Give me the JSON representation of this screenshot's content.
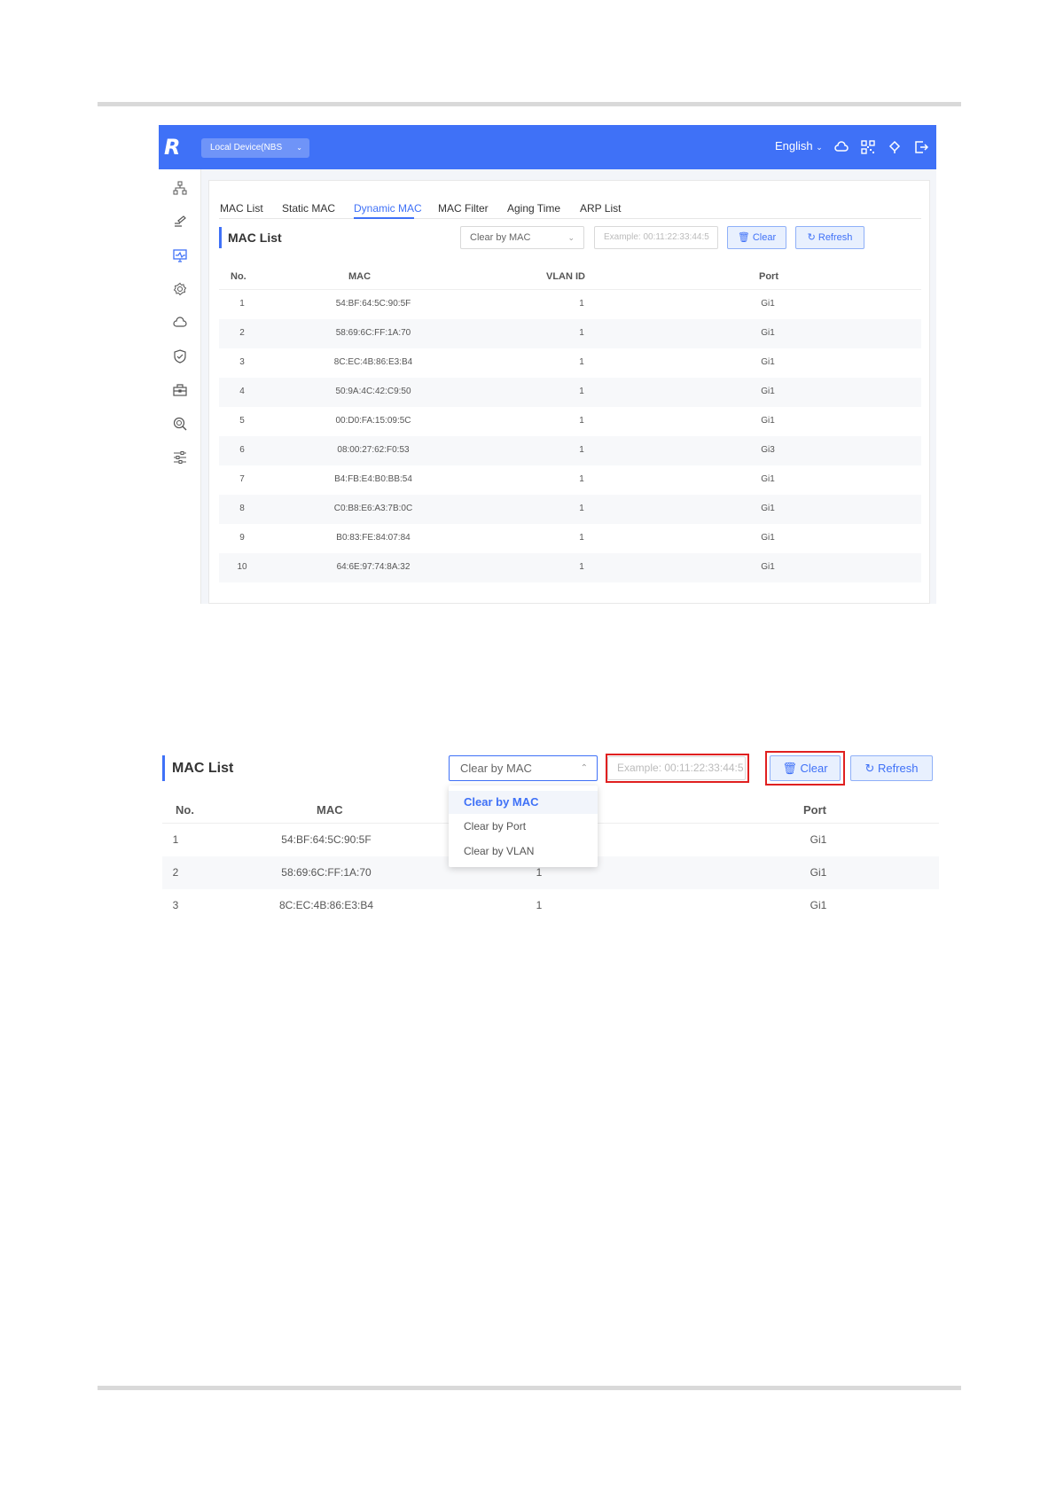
{
  "shot1": {
    "device_selector": "Local Device(NBS",
    "language": "English",
    "tabs": [
      "MAC List",
      "Static MAC",
      "Dynamic MAC",
      "MAC Filter",
      "Aging Time",
      "ARP List"
    ],
    "active_tab": "Dynamic MAC",
    "panel_title": "MAC List",
    "clear_select": "Clear by MAC",
    "mac_input_placeholder": "Example: 00:11:22:33:44:5",
    "clear_button": "Clear",
    "refresh_button": "Refresh",
    "columns": [
      "No.",
      "MAC",
      "VLAN ID",
      "Port"
    ],
    "rows": [
      [
        "1",
        "54:BF:64:5C:90:5F",
        "1",
        "Gi1"
      ],
      [
        "2",
        "58:69:6C:FF:1A:70",
        "1",
        "Gi1"
      ],
      [
        "3",
        "8C:EC:4B:86:E3:B4",
        "1",
        "Gi1"
      ],
      [
        "4",
        "50:9A:4C:42:C9:50",
        "1",
        "Gi1"
      ],
      [
        "5",
        "00:D0:FA:15:09:5C",
        "1",
        "Gi1"
      ],
      [
        "6",
        "08:00:27:62:F0:53",
        "1",
        "Gi3"
      ],
      [
        "7",
        "B4:FB:E4:B0:BB:54",
        "1",
        "Gi1"
      ],
      [
        "8",
        "C0:B8:E6:A3:7B:0C",
        "1",
        "Gi1"
      ],
      [
        "9",
        "B0:83:FE:84:07:84",
        "1",
        "Gi1"
      ],
      [
        "10",
        "64:6E:97:74:8A:32",
        "1",
        "Gi1"
      ]
    ]
  },
  "shot2": {
    "panel_title": "MAC List",
    "clear_select": "Clear by MAC",
    "mac_input_placeholder": "Example: 00:11:22:33:44:5",
    "clear_button": "Clear",
    "refresh_button": "Refresh",
    "dropdown_options": [
      "Clear by MAC",
      "Clear by Port",
      "Clear by VLAN"
    ],
    "columns": [
      "No.",
      "MAC",
      "Port"
    ],
    "rows": [
      [
        "1",
        "54:BF:64:5C:90:5F",
        "",
        "Gi1"
      ],
      [
        "2",
        "58:69:6C:FF:1A:70",
        "1",
        "Gi1"
      ],
      [
        "3",
        "8C:EC:4B:86:E3:B4",
        "1",
        "Gi1"
      ]
    ]
  },
  "colors": {
    "accent": "#3f71f7",
    "highlight": "#e02020"
  },
  "icons": {
    "topbar": [
      "cloud-icon",
      "qr-code-icon",
      "notification-icon",
      "logout-icon"
    ],
    "sidebar": [
      "topology-icon",
      "ports-icon",
      "monitor-icon",
      "settings-icon",
      "cloud-icon",
      "security-icon",
      "toolbox-icon",
      "diagnostics-icon",
      "advanced-icon"
    ]
  }
}
